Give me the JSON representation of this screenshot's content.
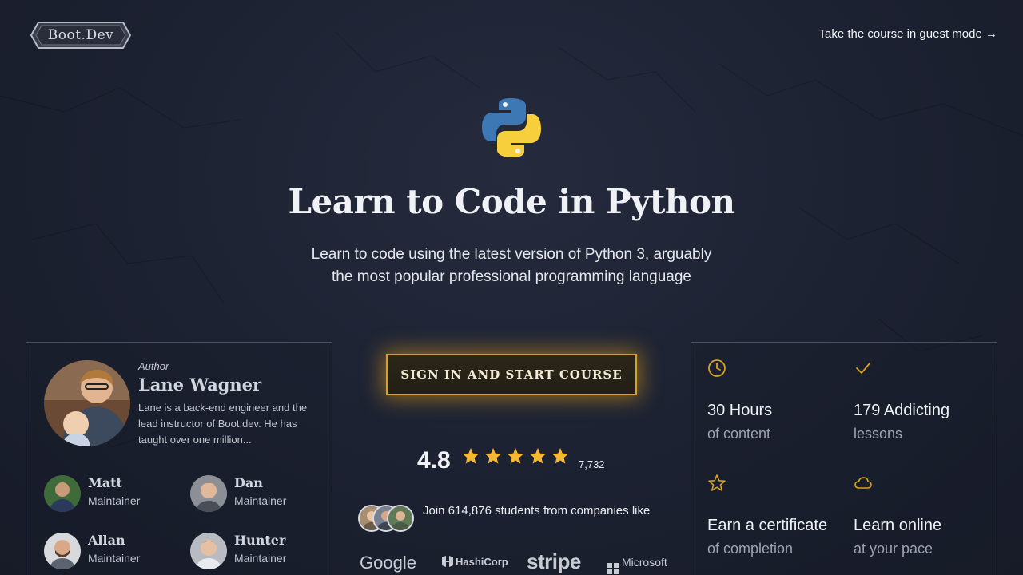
{
  "header": {
    "logo_text": "Boot.Dev",
    "guest_link": "Take the course in guest mode →"
  },
  "hero": {
    "icon": "python-logo",
    "title": "Learn to Code in Python",
    "subtitle": "Learn to code using the latest version of Python 3, arguably the most popular professional programming language"
  },
  "author": {
    "role": "Author",
    "name": "Lane Wagner",
    "bio": "Lane is a back-end engineer and the lead instructor of Boot.dev. He has taught over one million...",
    "maintainers": [
      {
        "name": "Matt",
        "role": "Maintainer"
      },
      {
        "name": "Dan",
        "role": "Maintainer"
      },
      {
        "name": "Allan",
        "role": "Maintainer"
      },
      {
        "name": "Hunter",
        "role": "Maintainer"
      }
    ]
  },
  "cta": {
    "label": "SIGN IN AND START COURSE"
  },
  "rating": {
    "score": "4.8",
    "stars": 5,
    "count": "7,732"
  },
  "social_proof": {
    "text": "Join 614,876 students from companies like",
    "companies": [
      "Google",
      "HashiCorp",
      "stripe",
      "Microsoft"
    ]
  },
  "features": [
    {
      "icon": "clock-icon",
      "title": "30 Hours",
      "subtitle": "of content"
    },
    {
      "icon": "check-icon",
      "title": "179 Addicting",
      "subtitle": "lessons"
    },
    {
      "icon": "star-icon",
      "title": "Earn a certificate",
      "subtitle": "of completion"
    },
    {
      "icon": "cloud-icon",
      "title": "Learn online",
      "subtitle": "at your pace"
    }
  ],
  "colors": {
    "background": "#1c2131",
    "accent_gold": "#d9a21f",
    "star_gold": "#f5b833",
    "card_border": "#4b5163"
  }
}
